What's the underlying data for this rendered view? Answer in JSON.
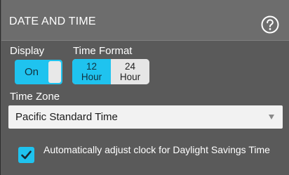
{
  "header": {
    "title": "DATE AND TIME",
    "help_icon": "help-icon"
  },
  "display": {
    "label": "Display",
    "toggle_text": "On",
    "state": "on"
  },
  "time_format": {
    "label": "Time Format",
    "options": [
      {
        "line1": "12",
        "line2": "Hour",
        "selected": true
      },
      {
        "line1": "24",
        "line2": "Hour",
        "selected": false
      }
    ]
  },
  "time_zone": {
    "label": "Time Zone",
    "value": "Pacific Standard Time"
  },
  "dst": {
    "checked": true,
    "label": "Automatically adjust clock for Daylight Savings Time"
  },
  "colors": {
    "accent": "#1fc3ef",
    "panel": "#5a5a5a",
    "header": "#6d6d6d"
  }
}
